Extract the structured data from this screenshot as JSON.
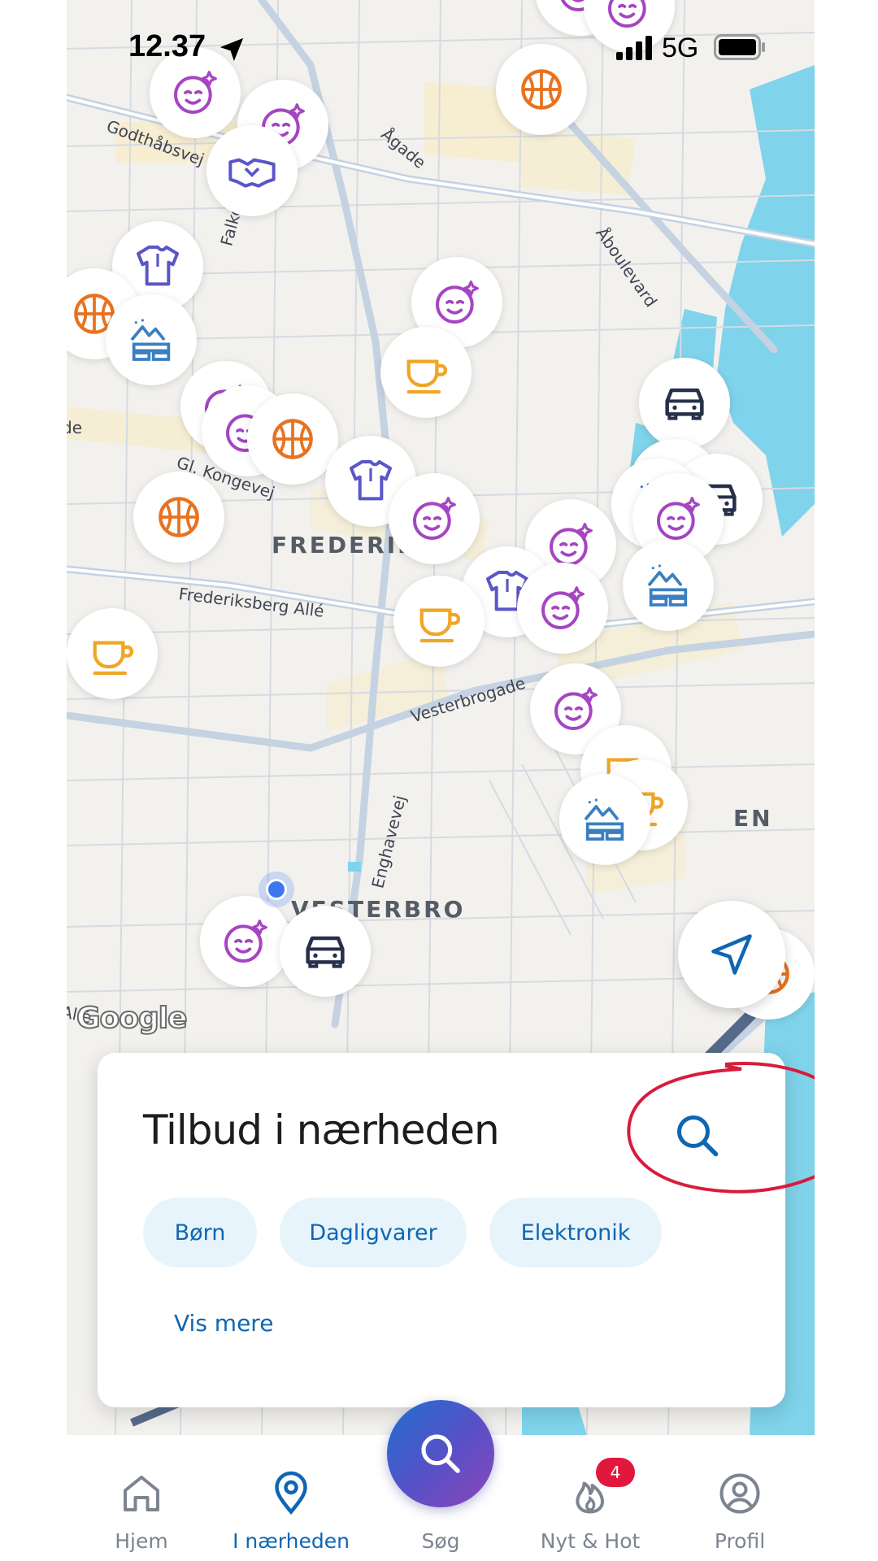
{
  "status_bar": {
    "time": "12.37",
    "network": "5G"
  },
  "map": {
    "street_labels": [
      "Godthåbsvej",
      "Ågade",
      "Åboulevard",
      "Falkoner",
      "Gl. Kongevej",
      "Frederiksberg Allé",
      "Vesterbrogade",
      "Enghavevej",
      "Allé",
      "de"
    ],
    "district_labels": [
      "FREDERIKS",
      "VESTERBRO",
      "EN"
    ],
    "attribution": "Google",
    "marker_types": [
      "beauty-icon",
      "basketball-icon",
      "handshake-icon",
      "shirt-icon",
      "travel-icon",
      "cup-icon",
      "car-icon"
    ]
  },
  "offers_card": {
    "title": "Tilbud i nærheden",
    "search_icon": "search-icon",
    "chips": [
      "Børn",
      "Dagligvarer",
      "Elektronik"
    ],
    "show_more": "Vis mere",
    "highlight_color": "#d81b3c"
  },
  "bottom_nav": {
    "items": [
      {
        "label": "Hjem",
        "icon": "home-icon"
      },
      {
        "label": "I nærheden",
        "icon": "location-pin-icon"
      },
      {
        "label": "Søg",
        "icon": "search-icon"
      },
      {
        "label": "Nyt & Hot",
        "icon": "flame-icon",
        "badge": "4"
      },
      {
        "label": "Profil",
        "icon": "profile-icon"
      }
    ],
    "active": "I nærheden"
  },
  "colors": {
    "accent": "#0f66b3",
    "beauty": "#a545c2",
    "sport": "#e8721f",
    "cafe": "#f0a625",
    "kids": "#5a56c9",
    "travel": "#3a7fc1",
    "car": "#26304a",
    "badge": "#e2173d"
  }
}
